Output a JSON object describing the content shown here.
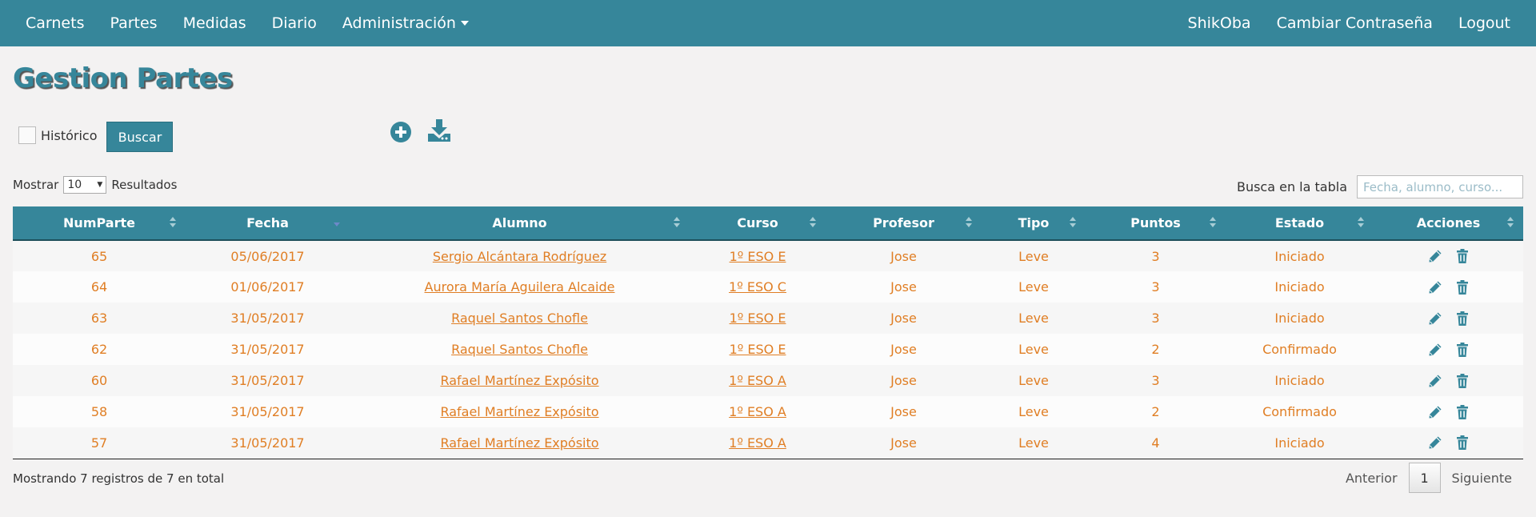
{
  "nav": {
    "left": [
      "Carnets",
      "Partes",
      "Medidas",
      "Diario"
    ],
    "admin_label": "Administración",
    "user": "ShikOba",
    "change_password": "Cambiar Contraseña",
    "logout": "Logout"
  },
  "page": {
    "title": "Gestion Partes"
  },
  "filters": {
    "historico_label": "Histórico",
    "historico_checked": false,
    "buscar_label": "Buscar"
  },
  "toolbar_icons": [
    "plus-circle-icon",
    "download-icon"
  ],
  "length": {
    "prefix": "Mostrar",
    "value": "10",
    "suffix": "Resultados"
  },
  "search": {
    "label": "Busca en la tabla",
    "placeholder": "Fecha, alumno, curso...",
    "value": ""
  },
  "table": {
    "columns": [
      "NumParte",
      "Fecha",
      "Alumno",
      "Curso",
      "Profesor",
      "Tipo",
      "Puntos",
      "Estado",
      "Acciones"
    ],
    "rows": [
      {
        "numparte": "65",
        "fecha": "05/06/2017",
        "alumno": "Sergio Alcántara Rodríguez",
        "curso": "1º ESO E",
        "profesor": "Jose",
        "tipo": "Leve",
        "puntos": "3",
        "estado": "Iniciado"
      },
      {
        "numparte": "64",
        "fecha": "01/06/2017",
        "alumno": "Aurora María Aguilera Alcaide",
        "curso": "1º ESO C",
        "profesor": "Jose",
        "tipo": "Leve",
        "puntos": "3",
        "estado": "Iniciado"
      },
      {
        "numparte": "63",
        "fecha": "31/05/2017",
        "alumno": "Raquel Santos Chofle",
        "curso": "1º ESO E",
        "profesor": "Jose",
        "tipo": "Leve",
        "puntos": "3",
        "estado": "Iniciado"
      },
      {
        "numparte": "62",
        "fecha": "31/05/2017",
        "alumno": "Raquel Santos Chofle",
        "curso": "1º ESO E",
        "profesor": "Jose",
        "tipo": "Leve",
        "puntos": "2",
        "estado": "Confirmado"
      },
      {
        "numparte": "60",
        "fecha": "31/05/2017",
        "alumno": "Rafael Martínez Expósito",
        "curso": "1º ESO A",
        "profesor": "Jose",
        "tipo": "Leve",
        "puntos": "3",
        "estado": "Iniciado"
      },
      {
        "numparte": "58",
        "fecha": "31/05/2017",
        "alumno": "Rafael Martínez Expósito",
        "curso": "1º ESO A",
        "profesor": "Jose",
        "tipo": "Leve",
        "puntos": "2",
        "estado": "Confirmado"
      },
      {
        "numparte": "57",
        "fecha": "31/05/2017",
        "alumno": "Rafael Martínez Expósito",
        "curso": "1º ESO A",
        "profesor": "Jose",
        "tipo": "Leve",
        "puntos": "4",
        "estado": "Iniciado"
      }
    ]
  },
  "footer": {
    "info": "Mostrando 7 registros de 7 en total",
    "prev": "Anterior",
    "page": "1",
    "next": "Siguiente"
  },
  "colors": {
    "primary": "#36869a",
    "accent": "#e07e24",
    "background": "#f3f2f2"
  }
}
